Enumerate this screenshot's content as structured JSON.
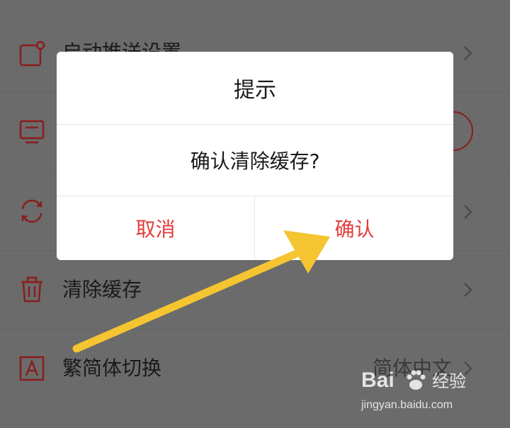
{
  "settings": {
    "items": [
      {
        "label": "启动推送设置",
        "icon": "note-icon"
      },
      {
        "label": "",
        "icon": "monitor-icon"
      },
      {
        "label": "",
        "icon": "refresh-icon"
      },
      {
        "label": "清除缓存",
        "icon": "trash-icon"
      },
      {
        "label": "繁简体切换",
        "value": "简体中文",
        "icon": "letter-a-icon"
      }
    ]
  },
  "dialog": {
    "title": "提示",
    "message": "确认清除缓存?",
    "cancel_label": "取消",
    "confirm_label": "确认"
  },
  "watermark": {
    "brand": "Bai",
    "sub": "经验",
    "url": "jingyan.baidu.com"
  },
  "colors": {
    "accent": "#e23a3a",
    "icon": "#8a1d1d",
    "arrow": "#f5c431",
    "overlay": "#6b6b6b"
  }
}
